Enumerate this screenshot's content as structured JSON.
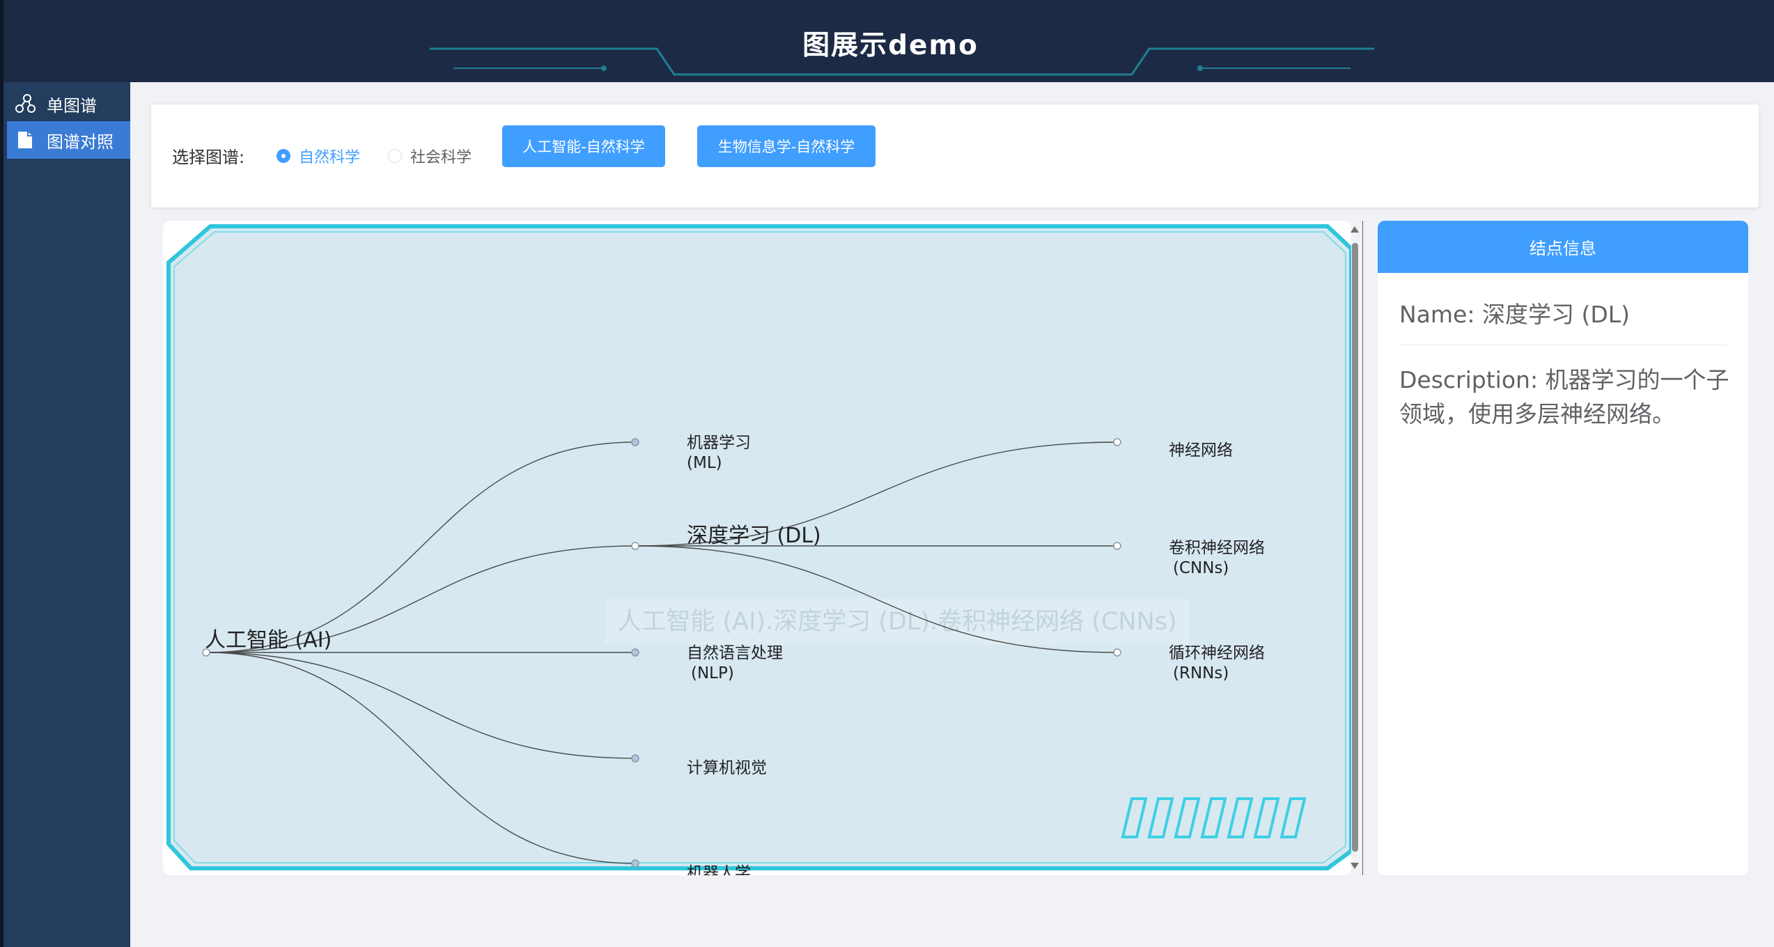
{
  "header": {
    "title": "图展示demo"
  },
  "sidebar": {
    "items": [
      {
        "label": "单图谱",
        "icon": "graph-nodes-icon",
        "active": false
      },
      {
        "label": "图谱对照",
        "icon": "document-icon",
        "active": true
      }
    ]
  },
  "toolbar": {
    "select_label": "选择图谱:",
    "radios": [
      {
        "label": "自然科学",
        "checked": true
      },
      {
        "label": "社会科学",
        "checked": false
      }
    ],
    "buttons": [
      {
        "label": "人工智能-自然科学"
      },
      {
        "label": "生物信息学-自然科学"
      }
    ]
  },
  "graph": {
    "root": "人工智能 (AI)",
    "level1": [
      {
        "line1": "机器学习",
        "line2": "(ML)"
      },
      {
        "line1": "深度学习 (DL)",
        "line2": ""
      },
      {
        "line1": "自然语言处理",
        "line2": "(NLP)"
      },
      {
        "line1": "计算机视觉",
        "line2": ""
      },
      {
        "line1": "机器人学",
        "line2": ""
      }
    ],
    "level2": [
      {
        "line1": "神经网络",
        "line2": ""
      },
      {
        "line1": "卷积神经网络",
        "line2": "(CNNs)"
      },
      {
        "line1": "循环神经网络",
        "line2": "(RNNs)"
      }
    ],
    "path_tooltip": "人工智能 (AI).深度学习 (DL).卷积神经网络 (CNNs)"
  },
  "info": {
    "header": "结点信息",
    "name": "Name: 深度学习 (DL)",
    "description": "Description: 机器学习的一个子领域，使用多层神经网络。"
  },
  "colors": {
    "topbar": "#1c2a45",
    "sidebar": "#223d5d",
    "accent": "#409eff",
    "graph_bg": "#d7e8f0",
    "graph_frame": "#2fc6dc"
  }
}
